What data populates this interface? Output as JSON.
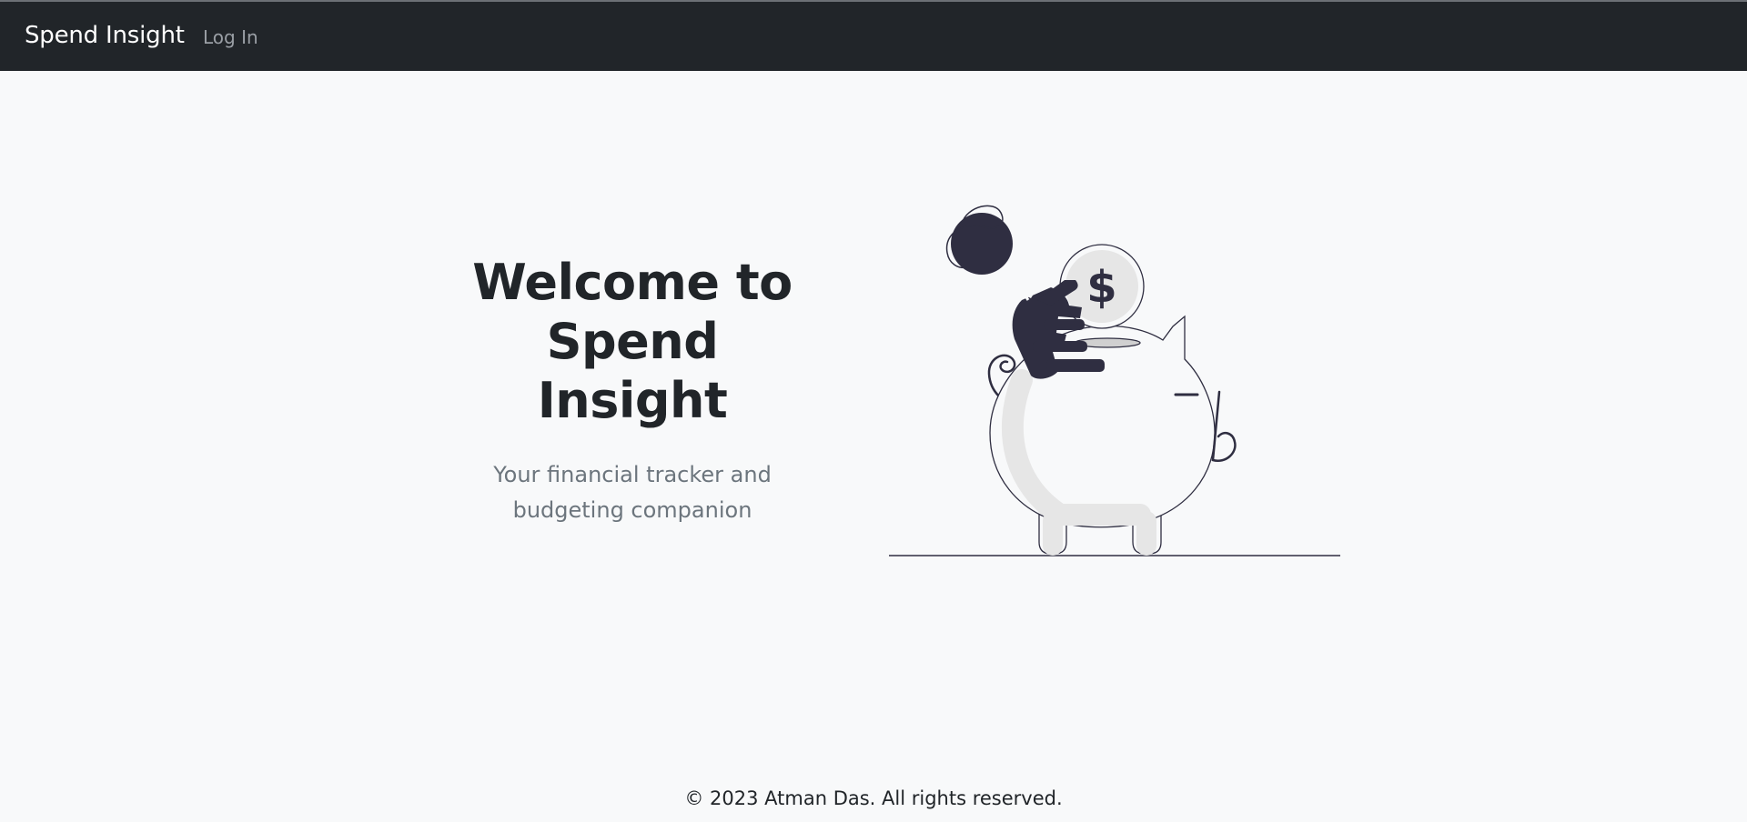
{
  "navbar": {
    "brand": "Spend Insight",
    "links": [
      {
        "label": "Log In"
      }
    ]
  },
  "hero": {
    "title_line1": "Welcome to",
    "title_line2": "Spend Insight",
    "subtitle_line1": "Your financial tracker and",
    "subtitle_line2": "budgeting companion"
  },
  "illustration": {
    "coin_symbol": "$",
    "icon_name": "piggy-bank-savings-illustration"
  },
  "footer": {
    "copyright": "© 2023 Atman Das. All rights reserved."
  },
  "colors": {
    "navbar_bg": "#212529",
    "page_bg": "#f8f9fa",
    "text_dark": "#212529",
    "text_muted": "#6c757d",
    "illustration_dark": "#2f2e41",
    "illustration_light": "#e6e6e6"
  }
}
